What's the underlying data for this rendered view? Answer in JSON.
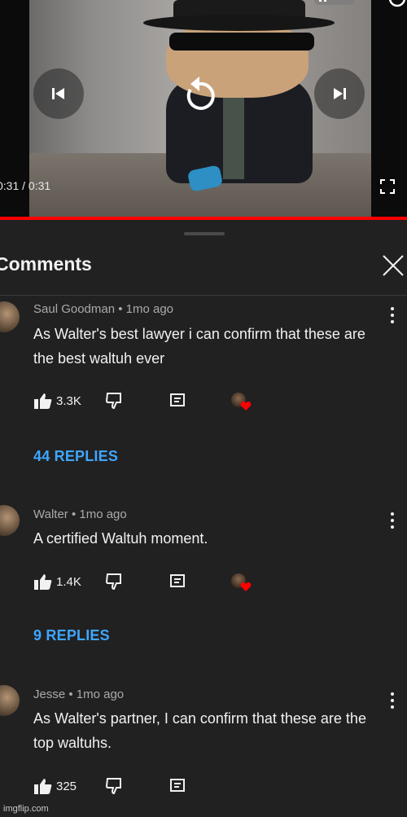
{
  "player": {
    "time_display": "0:31 / 0:31",
    "controls": [
      "previous-icon",
      "replay-icon",
      "next-icon",
      "fullscreen-icon"
    ],
    "progress_fraction": 1.0,
    "progress_color": "#ff0000"
  },
  "panel": {
    "title": "Comments",
    "close_icon": "close-icon"
  },
  "comments": [
    {
      "author_meta": "Saul Goodman • 1mo ago",
      "text": "As Walter's best lawyer  i can confirm that these are the best waltuh ever",
      "likes": "3.3K",
      "replies_label": "44 REPLIES",
      "creator_heart": true
    },
    {
      "author_meta": "Walter • 1mo ago",
      "text": "A certified Waltuh moment.",
      "likes": "1.4K",
      "replies_label": "9 REPLIES",
      "creator_heart": true
    },
    {
      "author_meta": "Jesse • 1mo ago",
      "text": "As Walter's partner, I can confirm that these are the top waltuhs.",
      "likes": "325",
      "creator_heart": false
    }
  ],
  "colors": {
    "background": "#212121",
    "link_blue": "#3ea6ff",
    "heart_red": "#ff0000"
  },
  "watermark": "imgflip.com"
}
